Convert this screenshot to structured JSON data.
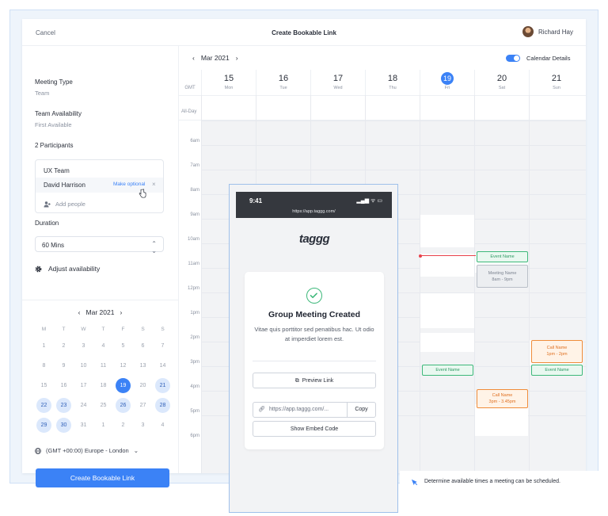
{
  "topbar": {
    "cancel": "Cancel",
    "title": "Create Bookable Link",
    "user_name": "Richard Hay"
  },
  "sidebar": {
    "meeting_type_label": "Meeting Type",
    "meeting_type_value": "Team",
    "team_avail_label": "Team Availability",
    "team_avail_value": "First Available",
    "participants_label": "2 Participants",
    "participants": {
      "team": "UX Team",
      "person": "David Harrison",
      "make_optional": "Make optional",
      "add_people": "Add people"
    },
    "duration_label": "Duration",
    "duration_value": "60 Mins",
    "adjust_label": "Adjust availability",
    "mini_cal": {
      "month": "Mar 2021",
      "dow": [
        "M",
        "T",
        "W",
        "T",
        "F",
        "S",
        "S"
      ],
      "weeks": [
        [
          {
            "d": "1",
            "s": "n"
          },
          {
            "d": "2",
            "s": "n"
          },
          {
            "d": "3",
            "s": "n"
          },
          {
            "d": "4",
            "s": "n"
          },
          {
            "d": "5",
            "s": "n"
          },
          {
            "d": "6",
            "s": "n"
          },
          {
            "d": "7",
            "s": "n"
          }
        ],
        [
          {
            "d": "8",
            "s": "n"
          },
          {
            "d": "9",
            "s": "n"
          },
          {
            "d": "10",
            "s": "n"
          },
          {
            "d": "11",
            "s": "n"
          },
          {
            "d": "12",
            "s": "n"
          },
          {
            "d": "13",
            "s": "n"
          },
          {
            "d": "14",
            "s": "n"
          }
        ],
        [
          {
            "d": "15",
            "s": "n"
          },
          {
            "d": "16",
            "s": "n"
          },
          {
            "d": "17",
            "s": "n"
          },
          {
            "d": "18",
            "s": "n"
          },
          {
            "d": "19",
            "s": "sel"
          },
          {
            "d": "20",
            "s": "n"
          },
          {
            "d": "21",
            "s": "a"
          }
        ],
        [
          {
            "d": "22",
            "s": "a"
          },
          {
            "d": "23",
            "s": "a"
          },
          {
            "d": "24",
            "s": "n"
          },
          {
            "d": "25",
            "s": "n"
          },
          {
            "d": "26",
            "s": "a"
          },
          {
            "d": "27",
            "s": "n"
          },
          {
            "d": "28",
            "s": "a"
          }
        ],
        [
          {
            "d": "29",
            "s": "a"
          },
          {
            "d": "30",
            "s": "a"
          },
          {
            "d": "31",
            "s": "n"
          },
          {
            "d": "1",
            "s": "n"
          },
          {
            "d": "2",
            "s": "n"
          },
          {
            "d": "3",
            "s": "n"
          },
          {
            "d": "4",
            "s": "n"
          }
        ]
      ]
    },
    "timezone": "(GMT +00:00) Europe - London",
    "cta": "Create Bookable Link"
  },
  "calendar": {
    "month": "Mar 2021",
    "details_label": "Calendar Details",
    "tz_label": "GMT",
    "allday_label": "All-Day",
    "days": [
      {
        "num": "15",
        "name": "Mon",
        "today": false
      },
      {
        "num": "16",
        "name": "Tue",
        "today": false
      },
      {
        "num": "17",
        "name": "Wed",
        "today": false
      },
      {
        "num": "18",
        "name": "Thu",
        "today": false
      },
      {
        "num": "19",
        "name": "Fri",
        "today": true
      },
      {
        "num": "20",
        "name": "Sat",
        "today": false
      },
      {
        "num": "21",
        "name": "Sun",
        "today": false
      }
    ],
    "hours": [
      "6am",
      "7am",
      "8am",
      "9am",
      "10am",
      "11am",
      "12pm",
      "1pm",
      "2pm",
      "3pm",
      "4pm",
      "5pm",
      "6pm"
    ],
    "events": {
      "sat_event": "Event Name",
      "sat_meeting_name": "Meeting Name",
      "sat_meeting_time": "8am - 9pm",
      "fri_event": "Event Name",
      "sun_call_name": "Call Name",
      "sun_call_time": "1pm - 2pm",
      "sun_event": "Event Name",
      "sat_call_name": "Call Name",
      "sat_call_time": "3pm - 3.45pm"
    },
    "hint": "Determine available times a meeting can be scheduled."
  },
  "phone": {
    "time": "9:41",
    "url": "https://app.taggg.com/",
    "logo": "taggg",
    "card_title": "Group Meeting Created",
    "card_desc": "Vitae quis porttitor sed penatibus hac. Ut odio at imperdiet lorem est.",
    "preview": "Preview Link",
    "link": "https://app.taggg.com/...",
    "copy": "Copy",
    "embed": "Show Embed Code"
  },
  "colors": {
    "accent": "#3b82f6",
    "event_green": "#3db87a",
    "event_orange": "#f08c3a",
    "now_line": "#e8404a"
  }
}
